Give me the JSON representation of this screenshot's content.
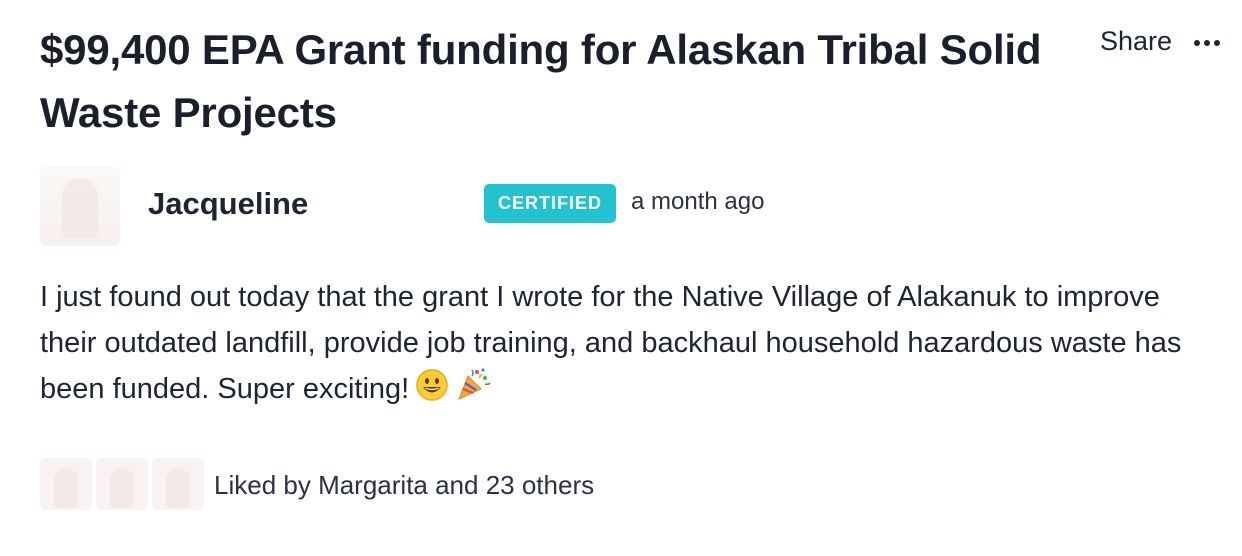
{
  "post": {
    "title": "$99,400 EPA Grant funding for Alaskan Tribal Solid Waste Projects",
    "share_label": "Share",
    "more_icon": "more-horizontal-icon"
  },
  "author": {
    "name": "Jacqueline",
    "badge": "CERTIFIED",
    "badge_color": "#22c3cf",
    "timestamp": "a month ago"
  },
  "content": {
    "text": "I just found out today that the grant I wrote for the Native Village of Alakanuk to improve their outdated landfill, provide job training, and backhaul household hazardous waste has been funded. Super exciting!",
    "emojis": [
      "grinning-face-icon",
      "party-popper-icon"
    ]
  },
  "likes": {
    "text": "Liked by Margarita and 23 others"
  }
}
